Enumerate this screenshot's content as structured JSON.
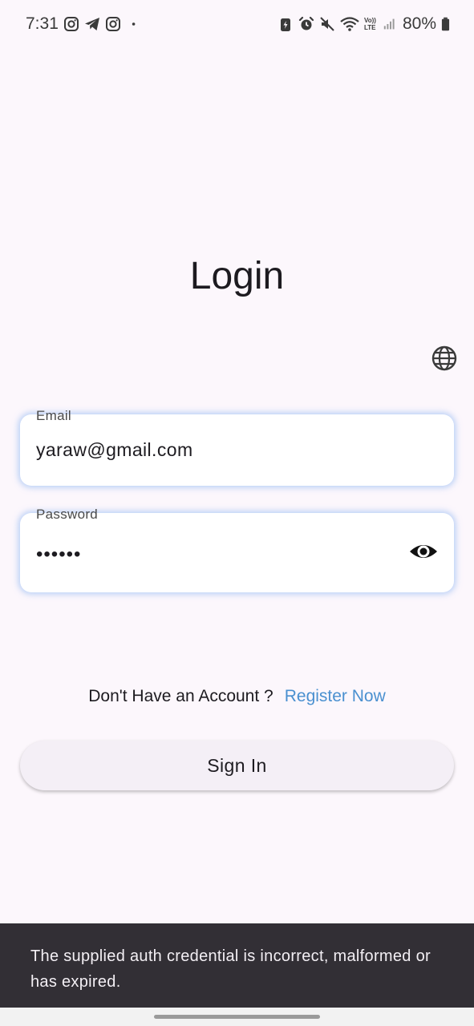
{
  "status_bar": {
    "time": "7:31",
    "left_icons": [
      "instagram-icon",
      "telegram-icon",
      "instagram-icon",
      "dot-icon"
    ],
    "right_icons": [
      "battery-saver-icon",
      "alarm-icon",
      "mute-icon",
      "wifi-icon",
      "volte-icon",
      "signal-icon"
    ],
    "volte_text": "Vo)) LTE",
    "battery_percent": "80%"
  },
  "title": "Login",
  "language_icon": "globe-icon",
  "email": {
    "label": "Email",
    "value": "yaraw@gmail.com"
  },
  "password": {
    "label": "Password",
    "masked_value": "••••••",
    "toggle_icon": "eye-icon"
  },
  "register": {
    "prompt": "Don't Have an Account ?",
    "link": "Register Now",
    "link_color": "#4a90d0"
  },
  "sign_in_label": "Sign In",
  "snackbar": {
    "message": "The supplied auth credential is incorrect, malformed or has expired."
  },
  "colors": {
    "background": "#fcf7fc",
    "field_glow": "#78aaf0",
    "snackbar_bg": "#322f35"
  }
}
